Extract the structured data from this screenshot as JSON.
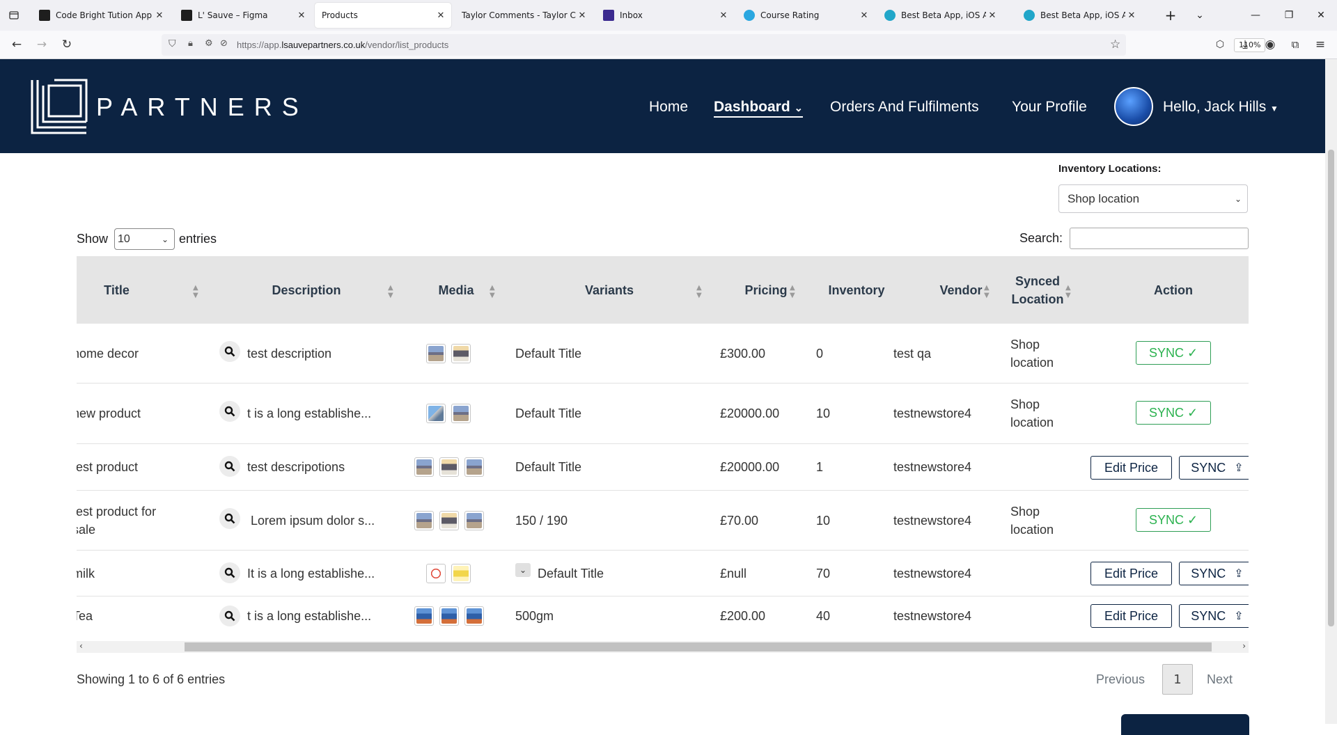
{
  "browser": {
    "tabs": [
      {
        "title": "Code Bright Tution App – F",
        "favicon_color": "#1e1e1e"
      },
      {
        "title": "L' Sauve – Figma",
        "favicon_color": "#1e1e1e"
      },
      {
        "title": "Products",
        "favicon_color": ""
      },
      {
        "title": "Taylor Comments - Taylor Com",
        "favicon_color": ""
      },
      {
        "title": "Inbox",
        "favicon_color": "#3b2a8f"
      },
      {
        "title": "Course Rating",
        "favicon_color": "#2aa7e0"
      },
      {
        "title": "Best Beta App, iOS App, An",
        "favicon_color": "#21a6c9"
      },
      {
        "title": "Best Beta App, iOS App, An",
        "favicon_color": "#21a6c9"
      }
    ],
    "url_prefix": "https://app.",
    "url_domain": "lsauvepartners.co.uk",
    "url_path": "/vendor/list_products",
    "zoom": "110%"
  },
  "header": {
    "logo_text": "PARTNERS",
    "nav": [
      "Home",
      "Dashboard",
      "Orders And Fulfilments",
      "Your Profile"
    ],
    "greeting": "Hello, Jack Hills"
  },
  "filters": {
    "inventory_label": "Inventory Locations:",
    "inventory_value": "Shop location",
    "show_label": "Show",
    "show_value": "10",
    "entries_label": "entries",
    "search_label": "Search:"
  },
  "table": {
    "columns": [
      "Title",
      "Description",
      "Media",
      "Variants",
      "Pricing",
      "Inventory",
      "Vendor",
      "Synced Location",
      "Action"
    ],
    "rows": [
      {
        "title": "home decor",
        "description": "test description",
        "variants": "Default Title",
        "pricing": "£300.00",
        "inventory": "0",
        "vendor": "test qa",
        "synced": "Shop location",
        "action": "SYNC ✓"
      },
      {
        "title": "new product",
        "description": "t is a long establishe...",
        "variants": "Default Title",
        "pricing": "£20000.00",
        "inventory": "10",
        "vendor": "testnewstore4",
        "synced": "Shop location",
        "action": "SYNC ✓"
      },
      {
        "title": "test product",
        "description": "test descripotions",
        "variants": "Default Title",
        "pricing": "£20000.00",
        "inventory": "1",
        "vendor": "testnewstore4",
        "synced": "",
        "edit": "Edit Price",
        "action": "SYNC"
      },
      {
        "title": "test product for sale",
        "description": "Lorem ipsum dolor s...",
        "variants": "150 / 190",
        "pricing": "£70.00",
        "inventory": "10",
        "vendor": "testnewstore4",
        "synced": "Shop location",
        "action": "SYNC ✓"
      },
      {
        "title": "milk",
        "description": "It is a long establishe...",
        "variants": "Default Title",
        "pricing": "£null",
        "inventory": "70",
        "vendor": "testnewstore4",
        "synced": "",
        "edit": "Edit Price",
        "action": "SYNC"
      },
      {
        "title": "Tea",
        "description": "t is a long establishe...",
        "variants": "500gm",
        "pricing": "£200.00",
        "inventory": "40",
        "vendor": "testnewstore4",
        "synced": "",
        "edit": "Edit Price",
        "action": "SYNC"
      }
    ]
  },
  "footer": {
    "info": "Showing 1 to 6 of 6 entries",
    "previous": "Previous",
    "page": "1",
    "next": "Next"
  }
}
